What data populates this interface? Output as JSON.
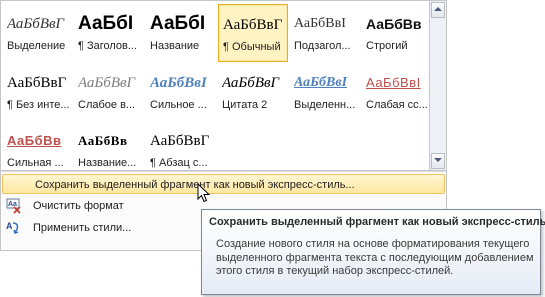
{
  "gallery": {
    "styles": [
      {
        "sample": "АаБбВвГ",
        "name": "Выделение",
        "style": "emph",
        "selected": false
      },
      {
        "sample": "АаБбI",
        "name": "¶ Заголов...",
        "style": "h1",
        "selected": false
      },
      {
        "sample": "АаБбI",
        "name": "Название",
        "style": "title",
        "selected": false
      },
      {
        "sample": "АаБбВвГ",
        "name": "¶ Обычный",
        "style": "normal",
        "selected": true
      },
      {
        "sample": "АаБбВвI",
        "name": "Подзагол...",
        "style": "subtitle",
        "selected": false
      },
      {
        "sample": "АаБбВв",
        "name": "Строгий",
        "style": "strict",
        "selected": false
      },
      {
        "sample": "АаБбВвГ",
        "name": "¶ Без инте...",
        "style": "nospace",
        "selected": false
      },
      {
        "sample": "АаБбВвГ",
        "name": "Слабое в...",
        "style": "weakemph",
        "selected": false
      },
      {
        "sample": "АаБбВвІ",
        "name": "Сильное ...",
        "style": "strongemph",
        "selected": false
      },
      {
        "sample": "АаБбВвГ",
        "name": "Цитата 2",
        "style": "quote2",
        "selected": false
      },
      {
        "sample": "АаБбВвІ",
        "name": "Выделенн...",
        "style": "selquote",
        "selected": false
      },
      {
        "sample": "АаБбВвІ",
        "name": "Слабая сс...",
        "style": "weakref",
        "selected": false
      },
      {
        "sample": "АаБбВв",
        "name": "Сильная ...",
        "style": "strongref",
        "selected": false
      },
      {
        "sample": "АаБбВв",
        "name": "Название...",
        "style": "booktitle",
        "selected": false
      },
      {
        "sample": "АаБбВвГ",
        "name": "¶ Абзац с...",
        "style": "list",
        "selected": false
      }
    ]
  },
  "scrollbar": {
    "up_icon": "arrow-up-icon",
    "down_icon": "arrow-down-icon",
    "more_icon": "more-icon"
  },
  "menu": {
    "save_quick_style": "Сохранить выделенный фрагмент как новый экспресс-стиль...",
    "clear_format": "Очистить формат",
    "apply_styles": "Применить стили..."
  },
  "tooltip": {
    "title": "Сохранить выделенный фрагмент как новый экспресс-стиль",
    "body": "Создание нового стиля на основе форматирования текущего выделенного фрагмента текста с последующим добавлением этого стиля в текущий набор экспресс-стилей."
  },
  "colors": {
    "selected_border": "#e8b02a",
    "hover_bg": "#ffe8a0",
    "accent_blue": "#4f81bd",
    "accent_red": "#c0504d"
  }
}
